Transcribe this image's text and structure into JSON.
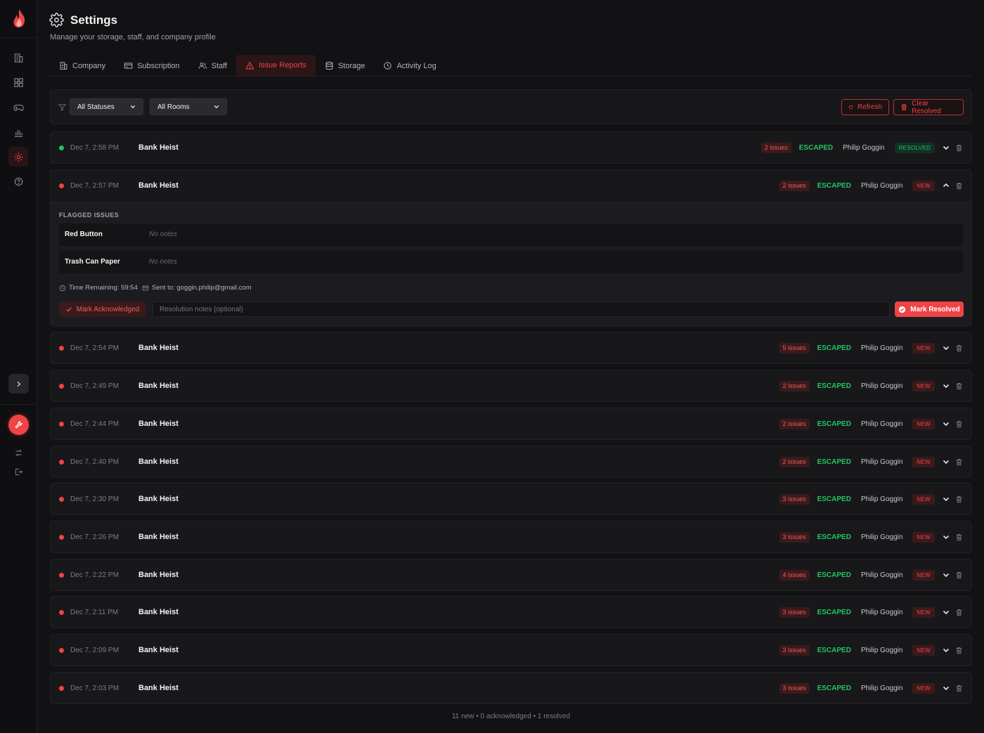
{
  "header": {
    "title": "Settings",
    "subtitle": "Manage your storage, staff, and company profile"
  },
  "tabs": [
    {
      "label": "Company",
      "icon": "building-icon"
    },
    {
      "label": "Subscription",
      "icon": "card-icon"
    },
    {
      "label": "Staff",
      "icon": "users-icon"
    },
    {
      "label": "Issue Reports",
      "icon": "warning-icon",
      "active": true
    },
    {
      "label": "Storage",
      "icon": "database-icon"
    },
    {
      "label": "Activity Log",
      "icon": "clock-icon"
    }
  ],
  "filters": {
    "status": "All Statuses",
    "room": "All Rooms",
    "refresh_label": "Refresh",
    "clear_label": "Clear Resolved"
  },
  "reports": [
    {
      "time": "Dec 7, 2:58 PM",
      "room": "Bank Heist",
      "issues": "2 issues",
      "outcome": "ESCAPED",
      "staff": "Philip Goggin",
      "status": "RESOLVED"
    },
    {
      "time": "Dec 7, 2:57 PM",
      "room": "Bank Heist",
      "issues": "2 issues",
      "outcome": "ESCAPED",
      "staff": "Philip Goggin",
      "status": "NEW"
    },
    {
      "time": "Dec 7, 2:54 PM",
      "room": "Bank Heist",
      "issues": "5 issues",
      "outcome": "ESCAPED",
      "staff": "Philip Goggin",
      "status": "NEW"
    },
    {
      "time": "Dec 7, 2:49 PM",
      "room": "Bank Heist",
      "issues": "2 issues",
      "outcome": "ESCAPED",
      "staff": "Philip Goggin",
      "status": "NEW"
    },
    {
      "time": "Dec 7, 2:44 PM",
      "room": "Bank Heist",
      "issues": "2 issues",
      "outcome": "ESCAPED",
      "staff": "Philip Goggin",
      "status": "NEW"
    },
    {
      "time": "Dec 7, 2:40 PM",
      "room": "Bank Heist",
      "issues": "2 issues",
      "outcome": "ESCAPED",
      "staff": "Philip Goggin",
      "status": "NEW"
    },
    {
      "time": "Dec 7, 2:30 PM",
      "room": "Bank Heist",
      "issues": "3 issues",
      "outcome": "ESCAPED",
      "staff": "Philip Goggin",
      "status": "NEW"
    },
    {
      "time": "Dec 7, 2:26 PM",
      "room": "Bank Heist",
      "issues": "3 issues",
      "outcome": "ESCAPED",
      "staff": "Philip Goggin",
      "status": "NEW"
    },
    {
      "time": "Dec 7, 2:22 PM",
      "room": "Bank Heist",
      "issues": "4 issues",
      "outcome": "ESCAPED",
      "staff": "Philip Goggin",
      "status": "NEW"
    },
    {
      "time": "Dec 7, 2:11 PM",
      "room": "Bank Heist",
      "issues": "3 issues",
      "outcome": "ESCAPED",
      "staff": "Philip Goggin",
      "status": "NEW"
    },
    {
      "time": "Dec 7, 2:09 PM",
      "room": "Bank Heist",
      "issues": "3 issues",
      "outcome": "ESCAPED",
      "staff": "Philip Goggin",
      "status": "NEW"
    },
    {
      "time": "Dec 7, 2:03 PM",
      "room": "Bank Heist",
      "issues": "3 issues",
      "outcome": "ESCAPED",
      "staff": "Philip Goggin",
      "status": "NEW"
    }
  ],
  "expanded": {
    "section_label": "FLAGGED ISSUES",
    "items": [
      {
        "name": "Red Button",
        "notes": "No notes"
      },
      {
        "name": "Trash Can Paper",
        "notes": "No notes"
      }
    ],
    "time_remaining": "Time Remaining: 59:54",
    "sent_to": "Sent to: goggin.philip@gmail.com",
    "ack_label": "Mark Acknowledged",
    "notes_placeholder": "Resolution notes (optional)",
    "resolve_label": "Mark Resolved"
  },
  "summary": "11 new • 0 acknowledged • 1 resolved",
  "colors": {
    "accent": "#ef4444",
    "success": "#22c55e",
    "background": "#121214",
    "panel": "#18181b"
  }
}
